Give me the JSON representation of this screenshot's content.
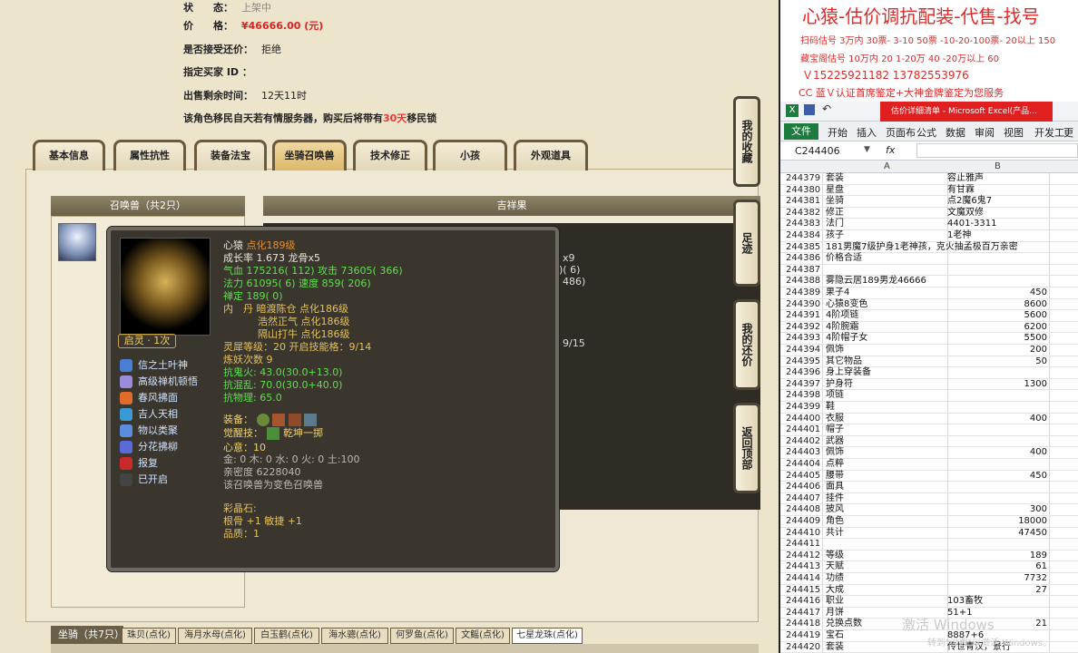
{
  "trade_info": {
    "status_label": "状　　态：",
    "status_value": "上架中",
    "price_label": "价　　格：",
    "price_value": "¥46666.00 (元)",
    "counter_label": "是否接受还价：",
    "counter_value": "拒绝",
    "buyer_label": "指定买家 ID ：",
    "buyer_value": "",
    "remain_label": "出售剩余时间：",
    "remain_value": "12天11时",
    "migrate_note_a": "该角色移民自天若有情服务器，购买后将带有",
    "migrate_days": "30天",
    "migrate_note_b": "移民锁"
  },
  "tabs": [
    "基本信息",
    "属性抗性",
    "装备法宝",
    "坐骑召唤兽",
    "技术修正",
    "小孩",
    "外观道具"
  ],
  "active_tab": "坐骑召唤兽",
  "summon_header": "召唤兽（共2只）",
  "luck_header": "吉祥果",
  "side_buttons": [
    "我的收藏",
    "足迹",
    "我的还价",
    "返回顶部"
  ],
  "tooltip": {
    "name": "心猿",
    "name_extra": "点化189级",
    "growth": "成长率 1.673 龙骨x5",
    "hp": "气血 175216( 112) 攻击 73605( 366)",
    "mp": "法力 61095( 6) 速度 859( 206)",
    "zen": "禅定 189( 0)",
    "neidan1": "内　丹 暗渡陈仓 点化186级",
    "neidan2": "浩然正气 点化186级",
    "neidan3": "隔山打牛 点化186级",
    "aura": "灵犀等级：20 开启技能格：9/14",
    "refine": "炼妖次数 9",
    "res1": "抗鬼火: 43.0(30.0+13.0)",
    "res2": "抗混乱: 70.0(30.0+40.0)",
    "res3": "抗物理: 65.0",
    "equip_label": "装备：",
    "awaken_label": "觉醒技：",
    "awaken_value": "乾坤一掷",
    "heart": "心意：10",
    "elements": "金: 0 木: 0 水: 0 火: 0 土:100",
    "intimacy": "亲密度 6228040",
    "variant_note": "该召唤兽为变色召唤兽",
    "gem_title": "彩晶石:",
    "gem_line": "根骨 +1 敏捷 +1",
    "quality": "品质：1",
    "qiling": "启灵 · 1次",
    "skills": [
      "信之土叶神",
      "高级禅机顿悟",
      "春风拂面",
      "吉人天相",
      "物以类聚",
      "分花拂柳",
      "报复",
      "已开启"
    ],
    "skill_colors": [
      "#4a7fd6",
      "#9a8cd8",
      "#e26a2a",
      "#3a9ad6",
      "#5a8ce0",
      "#5a6ad6",
      "#c82a2a",
      "#444"
    ]
  },
  "behind": {
    "x9": "x9",
    "v6": ")( 6)",
    "v486": "486)",
    "v915": "9/15"
  },
  "bottom": {
    "label": "坐骑（共7只）",
    "tabs": [
      "珠贝(点化)",
      "海月水母(点化)",
      "白玉鹤(点化)",
      "海水骢(点化)",
      "何罗鱼(点化)",
      "文鳐(点化)",
      "七星龙珠(点化)"
    ]
  },
  "excel": {
    "banner1": "心猿-估价调抗配装-代售-找号",
    "banner2": "扫码估号 3万内 30票- 3-10 50票  -10-20-100票- 20以上 150",
    "banner3": "藏宝阁估号 10万内 20  1-20万 40  -20万以上 60",
    "banner4": "Ｖ15225921182   13782553976",
    "banner5": "CC 蓝Ｖ认证首席鉴定+大神金牌鉴定为您服务",
    "title_label": "估价详细清单 - Microsoft Excel(产品...",
    "menu": [
      "文件",
      "开始",
      "插入",
      "页面布",
      "公式",
      "数据",
      "审阅",
      "视图",
      "开发工",
      "更多"
    ],
    "name_box": "C244406",
    "fx": "fx",
    "col_a": "A",
    "col_b": "B",
    "rows": [
      [
        "244379",
        "套装",
        "容止雅声"
      ],
      [
        "244380",
        "星盘",
        "有甘霖"
      ],
      [
        "244381",
        "坐骑",
        "点2魔6鬼7"
      ],
      [
        "244382",
        "修正",
        "文魔双修"
      ],
      [
        "244383",
        "法门",
        "4401-3311"
      ],
      [
        "244384",
        "孩子",
        "1老神"
      ],
      [
        "244385",
        "181男魔7级护身1老神孩，克火抽孟极百万亲密",
        ""
      ],
      [
        "244386",
        "价格合适",
        ""
      ],
      [
        "244387",
        "",
        ""
      ],
      [
        "244388",
        "雾隐云居189男龙46666",
        ""
      ],
      [
        "244389",
        "果子4",
        "450"
      ],
      [
        "244390",
        "心猿8变色",
        "8600"
      ],
      [
        "244391",
        "4阶项链",
        "5600"
      ],
      [
        "244392",
        "4阶腕霜",
        "6200"
      ],
      [
        "244393",
        "4阶帽子女",
        "5500"
      ],
      [
        "244394",
        "佩饰",
        "200"
      ],
      [
        "244395",
        "其它物品",
        "50"
      ],
      [
        "244396",
        "身上穿装备",
        ""
      ],
      [
        "244397",
        "护身符",
        "1300"
      ],
      [
        "244398",
        "项链",
        ""
      ],
      [
        "244399",
        "鞋",
        ""
      ],
      [
        "244400",
        "衣服",
        "400"
      ],
      [
        "244401",
        "帽子",
        ""
      ],
      [
        "244402",
        "武器",
        ""
      ],
      [
        "244403",
        "佩饰",
        "400"
      ],
      [
        "244404",
        "点粹",
        ""
      ],
      [
        "244405",
        "腰带",
        "450"
      ],
      [
        "244406",
        "面具",
        ""
      ],
      [
        "244407",
        "挂件",
        ""
      ],
      [
        "244408",
        "披风",
        "300"
      ],
      [
        "244409",
        "角色",
        "18000"
      ],
      [
        "244410",
        "共计",
        "47450"
      ],
      [
        "244411",
        "",
        ""
      ],
      [
        "244412",
        "等级",
        "189"
      ],
      [
        "244413",
        "天赋",
        "61"
      ],
      [
        "244414",
        "功绩",
        "7732"
      ],
      [
        "244415",
        "大成",
        "27"
      ],
      [
        "244416",
        "职业",
        "103畜牧"
      ],
      [
        "244417",
        "月饼",
        "51+1"
      ],
      [
        "244418",
        "兑换点数",
        "21"
      ],
      [
        "244419",
        "宝石",
        "8887+6"
      ],
      [
        "244420",
        "套装",
        "传世青汉，景行"
      ]
    ],
    "num_rows": [
      "244389",
      "244390",
      "244391",
      "244392",
      "244393",
      "244394",
      "244395",
      "244397",
      "244400",
      "244403",
      "244405",
      "244408",
      "244409",
      "244410",
      "244412",
      "244413",
      "244414",
      "244415",
      "244418"
    ],
    "activate1": "激活 Windows",
    "activate2": "转到\"设置\"以激活 Windows。"
  }
}
